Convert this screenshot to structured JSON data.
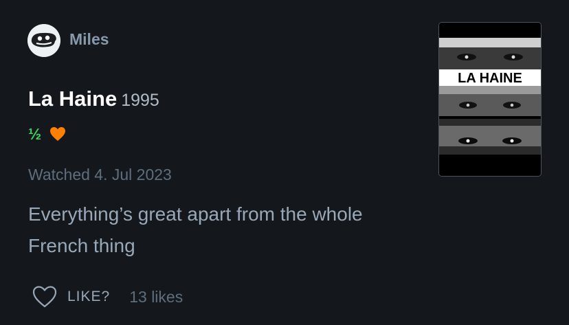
{
  "reviewer": {
    "name": "Miles",
    "avatar_icon": "cartoon-face-icon"
  },
  "film": {
    "title": "La Haine",
    "year": "1995",
    "poster_title": "LA HAINE"
  },
  "rating": {
    "stars": "½",
    "liked": true,
    "star_color": "#40d060",
    "heart_color": "#ff8000"
  },
  "watched": "Watched 4. Jul 2023",
  "review_text": "Everything’s great apart from the whole French thing",
  "like_bar": {
    "icon": "heart-outline-icon",
    "label": "LIKE?",
    "count": "13 likes"
  },
  "colors": {
    "background": "#14181c",
    "username": "#8799ab",
    "muted": "#5f6e7c",
    "body_text": "#99a8b8"
  }
}
